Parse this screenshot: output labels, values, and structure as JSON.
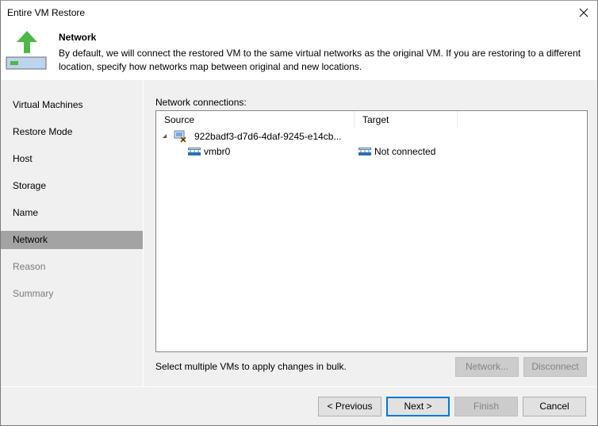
{
  "window": {
    "title": "Entire VM Restore",
    "close_icon": "close-icon"
  },
  "header": {
    "icon": "restore-upload-icon",
    "title": "Network",
    "description": "By default, we will connect the restored VM to the same virtual networks as the original VM. If you are restoring to a different location, specify how networks map between original and new locations."
  },
  "sidebar": {
    "items": [
      {
        "label": "Virtual Machines",
        "state": "normal"
      },
      {
        "label": "Restore Mode",
        "state": "normal"
      },
      {
        "label": "Host",
        "state": "normal"
      },
      {
        "label": "Storage",
        "state": "normal"
      },
      {
        "label": "Name",
        "state": "normal"
      },
      {
        "label": "Network",
        "state": "active"
      },
      {
        "label": "Reason",
        "state": "disabled"
      },
      {
        "label": "Summary",
        "state": "disabled"
      }
    ]
  },
  "main": {
    "connections_label": "Network connections:",
    "columns": [
      "Source",
      "Target"
    ],
    "rows": [
      {
        "type": "vm",
        "expanded": true,
        "source": "922badf3-d7d6-4daf-9245-e14cb...",
        "target": "",
        "icon": "vm-error-icon"
      },
      {
        "type": "network",
        "source": "vmbr0",
        "target": "Not connected",
        "icon": "network-icon"
      }
    ],
    "bulk_hint": "Select multiple VMs to apply changes in bulk.",
    "network_button": "Network...",
    "disconnect_button": "Disconnect"
  },
  "footer": {
    "previous": "< Previous",
    "next": "Next >",
    "finish": "Finish",
    "cancel": "Cancel"
  },
  "colors": {
    "active_nav": "#a3a3a3",
    "default_button_border": "#0078d7",
    "arrow_green": "#4db848"
  }
}
